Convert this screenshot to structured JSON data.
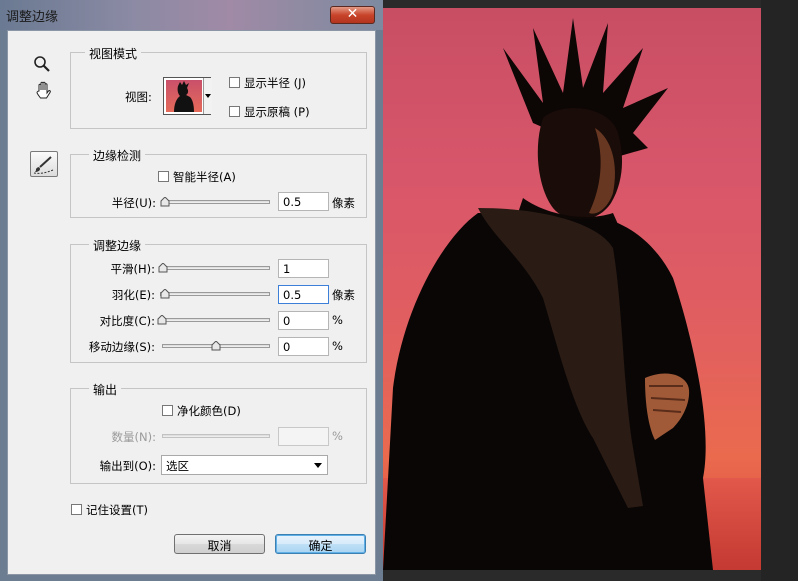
{
  "dialog": {
    "title": "调整边缘",
    "close_icon": "close-icon"
  },
  "tools": [
    "zoom-icon",
    "hand-icon",
    "refine-radius-brush-icon"
  ],
  "view_mode": {
    "legend": "视图模式",
    "view_label": "视图:",
    "show_radius_label": "显示半径 (J)",
    "show_original_label": "显示原稿 (P)",
    "show_radius_checked": false,
    "show_original_checked": false
  },
  "edge_detection": {
    "legend": "边缘检测",
    "smart_radius_label": "智能半径(A)",
    "smart_radius_checked": false,
    "radius_label": "半径(U):",
    "radius_value": "0.5",
    "radius_unit": "像素",
    "radius_slider": 0.0
  },
  "adjust_edge": {
    "legend": "调整边缘",
    "smooth_label": "平滑(H):",
    "smooth_value": "1",
    "smooth_slider": 0.0,
    "feather_label": "羽化(E):",
    "feather_value": "0.5",
    "feather_unit": "像素",
    "feather_slider": 0.0,
    "contrast_label": "对比度(C):",
    "contrast_value": "0",
    "contrast_unit": "%",
    "contrast_slider": 0.0,
    "shift_edge_label": "移动边缘(S):",
    "shift_edge_value": "0",
    "shift_edge_unit": "%",
    "shift_edge_slider": 0.5
  },
  "output": {
    "legend": "输出",
    "decontaminate_label": "净化颜色(D)",
    "decontaminate_checked": false,
    "amount_label": "数量(N):",
    "amount_value": "",
    "amount_unit": "%",
    "output_to_label": "输出到(O):",
    "output_to_value": "选区"
  },
  "remember_settings_label": "记住设置(T)",
  "remember_settings_checked": false,
  "buttons": {
    "cancel": "取消",
    "ok": "确定"
  },
  "colors": {
    "accent": "#3c7fd8",
    "close_red": "#c8442b",
    "photo_bg": "#d8566a"
  }
}
